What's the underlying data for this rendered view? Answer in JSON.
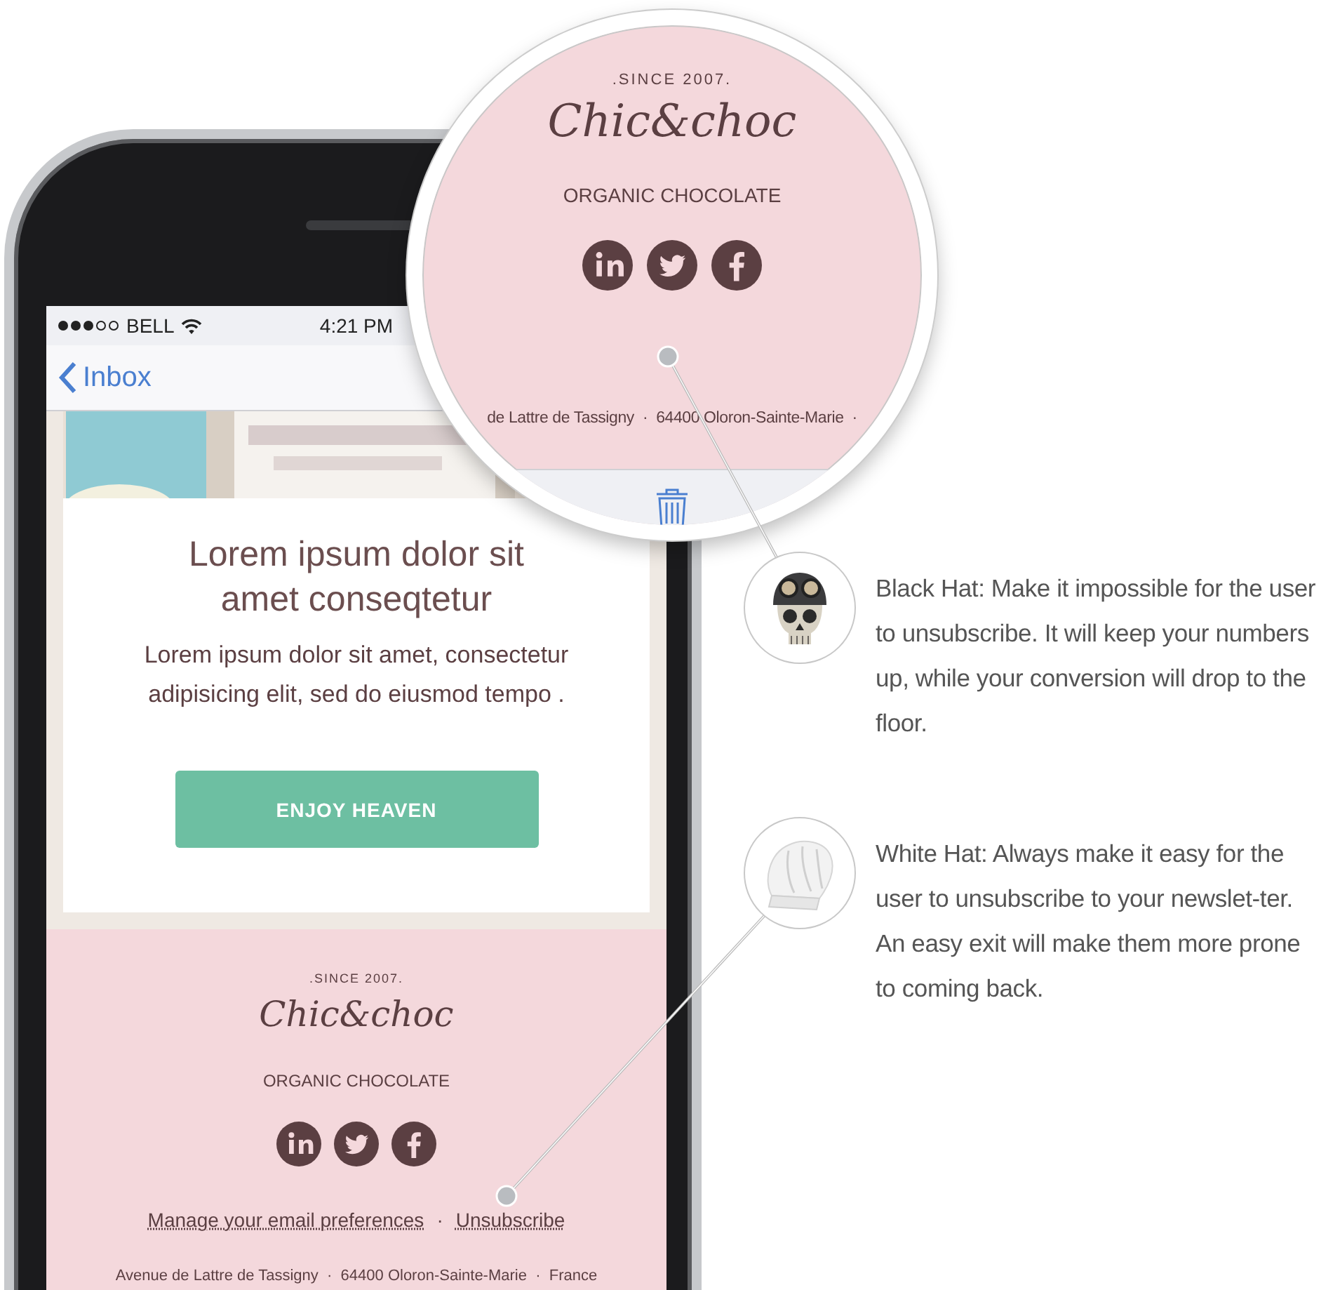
{
  "status_bar": {
    "carrier": "BELL",
    "time": "4:21 PM"
  },
  "nav": {
    "back_label": "Inbox"
  },
  "card": {
    "title": "Lorem ipsum dolor sit amet conseqtetur",
    "body": "Lorem ipsum dolor sit amet, consectetur adipisicing elit, sed do eiusmod tempo .",
    "button": "ENJOY HEAVEN"
  },
  "footer": {
    "since": ".SINCE 2007.",
    "logo": "Chic&choc",
    "tagline": "ORGANIC CHOCOLATE",
    "links": [
      "Manage your email preferences",
      "Unsubscribe"
    ],
    "link_separator": "·",
    "address": "Avenue de Lattre de Tassigny  ·  64400 Oloron-Sainte-Marie  ·  France"
  },
  "magnifier": {
    "since": ".SINCE 2007.",
    "logo": "Chic&choc",
    "tagline": "ORGANIC CHOCOLATE",
    "address": "de Lattre de Tassigny  ·  64400 Oloron-Sainte-Marie  ·"
  },
  "annotations": [
    {
      "kind": "skull",
      "text": "Black Hat: Make it impossible for the user to unsubscribe. It will keep your numbers up, while your conversion will drop to the floor."
    },
    {
      "kind": "chef",
      "text": "White Hat: Always make it easy for the user to unsubscribe to your newslet-ter. An easy exit will make them more prone to coming back."
    }
  ]
}
